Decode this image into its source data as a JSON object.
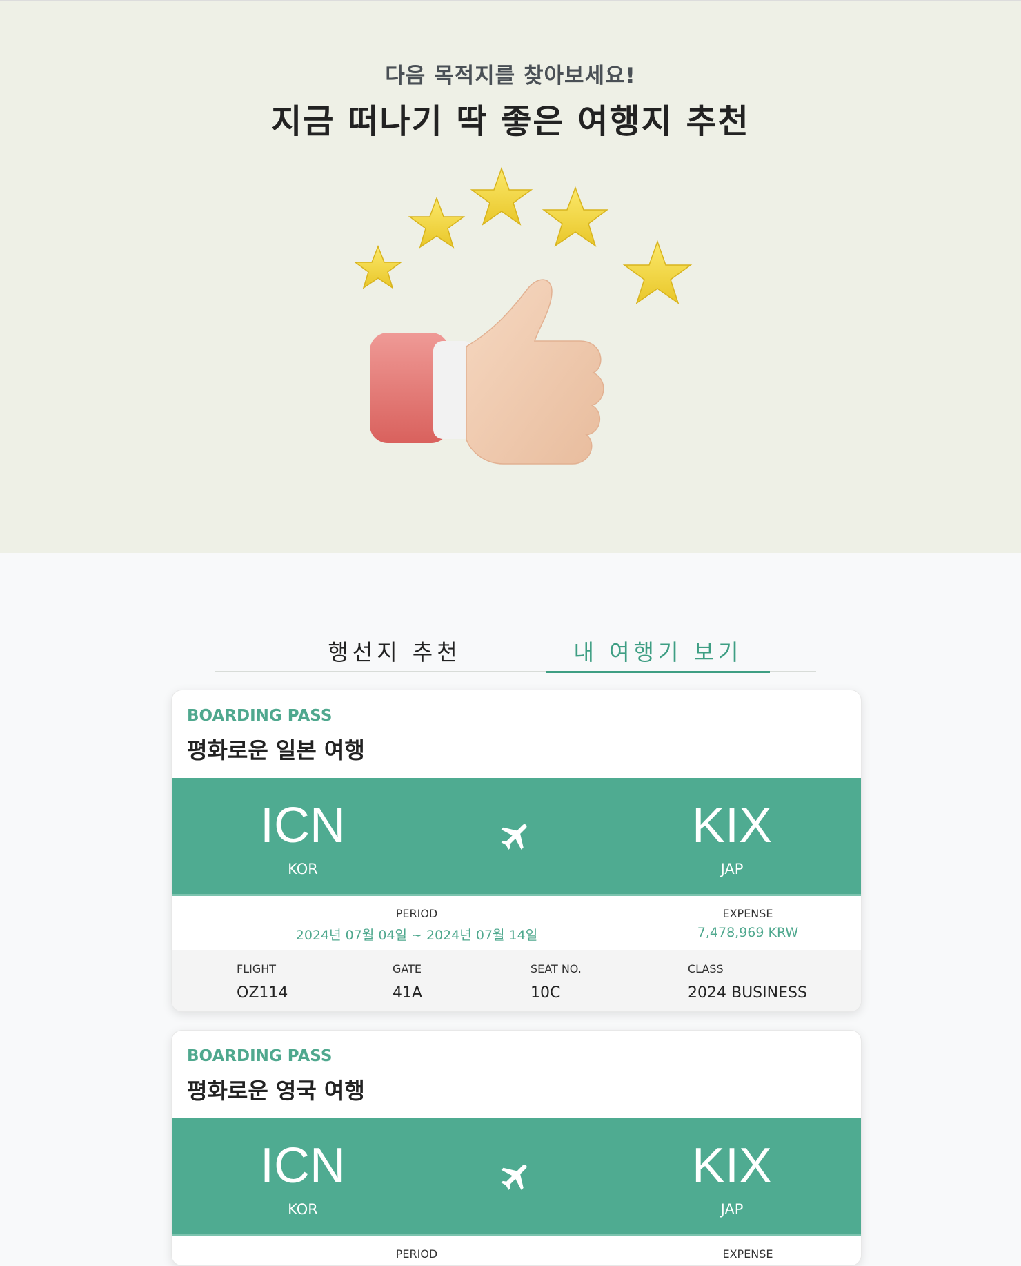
{
  "hero": {
    "subtitle": "다음 목적지를 찾아보세요!",
    "title": "지금 떠나기 딱 좋은 여행지 추천"
  },
  "tabs": [
    {
      "label": "행선지 추천",
      "active": false
    },
    {
      "label": "내 여행기 보기",
      "active": true
    }
  ],
  "colors": {
    "accent": "#4fab91",
    "hero_bg": "#eef0e6"
  },
  "cards": [
    {
      "label": "BOARDING PASS",
      "title": "평화로운 일본 여행",
      "from_code": "ICN",
      "from_country": "KOR",
      "to_code": "KIX",
      "to_country": "JAP",
      "period_label": "PERIOD",
      "period_value": "2024년 07월 04일 ~ 2024년 07월 14일",
      "expense_label": "EXPENSE",
      "expense_value": "7,478,969 KRW",
      "flight_label": "FLIGHT",
      "flight_value": "OZ114",
      "gate_label": "GATE",
      "gate_value": "41A",
      "seat_label": "SEAT NO.",
      "seat_value": "10C",
      "class_label": "CLASS",
      "class_value": "2024 BUSINESS"
    },
    {
      "label": "BOARDING PASS",
      "title": "평화로운 영국 여행",
      "from_code": "ICN",
      "from_country": "KOR",
      "to_code": "KIX",
      "to_country": "JAP",
      "period_label": "PERIOD",
      "expense_label": "EXPENSE"
    }
  ]
}
